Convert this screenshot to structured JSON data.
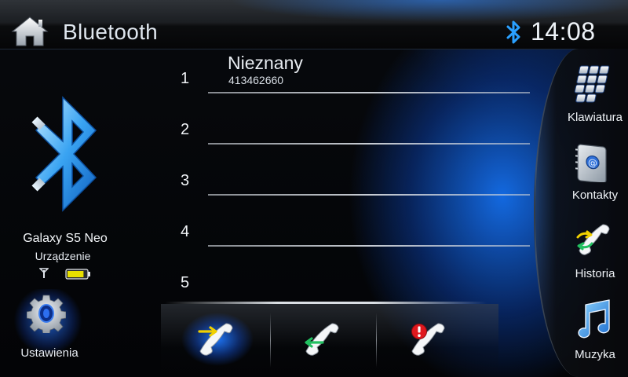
{
  "header": {
    "title": "Bluetooth",
    "home_icon": "home-icon",
    "status_icon": "bluetooth-icon",
    "time": "14:08"
  },
  "device": {
    "name": "Galaxy S5 Neo",
    "type": "Urządzenie",
    "signal_icon": "signal-icon",
    "battery_icon": "battery-icon",
    "battery_level": 0.85
  },
  "settings": {
    "label": "Ustawienia",
    "icon": "gear-icon"
  },
  "call_list": {
    "slots": [
      {
        "number": "1",
        "name": "Nieznany",
        "phone": "413462660"
      },
      {
        "number": "2",
        "name": "",
        "phone": ""
      },
      {
        "number": "3",
        "name": "",
        "phone": ""
      },
      {
        "number": "4",
        "name": "",
        "phone": ""
      },
      {
        "number": "5",
        "name": "",
        "phone": ""
      }
    ]
  },
  "actions": [
    {
      "name": "outgoing-calls",
      "icon": "outgoing-call-icon",
      "active": true
    },
    {
      "name": "incoming-calls",
      "icon": "incoming-call-icon",
      "active": false
    },
    {
      "name": "missed-calls",
      "icon": "missed-call-icon",
      "active": false
    }
  ],
  "menu": {
    "items": [
      {
        "label": "Klawiatura",
        "icon": "keypad-icon"
      },
      {
        "label": "Kontakty",
        "icon": "contacts-book-icon"
      },
      {
        "label": "Historia",
        "icon": "call-history-icon"
      },
      {
        "label": "Muzyka",
        "icon": "music-note-icon"
      }
    ]
  },
  "colors": {
    "accent": "#1e78ff",
    "bluetooth": "#2aa0ff",
    "battery": "#e8e000",
    "missed": "#e0181e",
    "outgoing": "#f0d000",
    "incoming": "#22c060"
  }
}
